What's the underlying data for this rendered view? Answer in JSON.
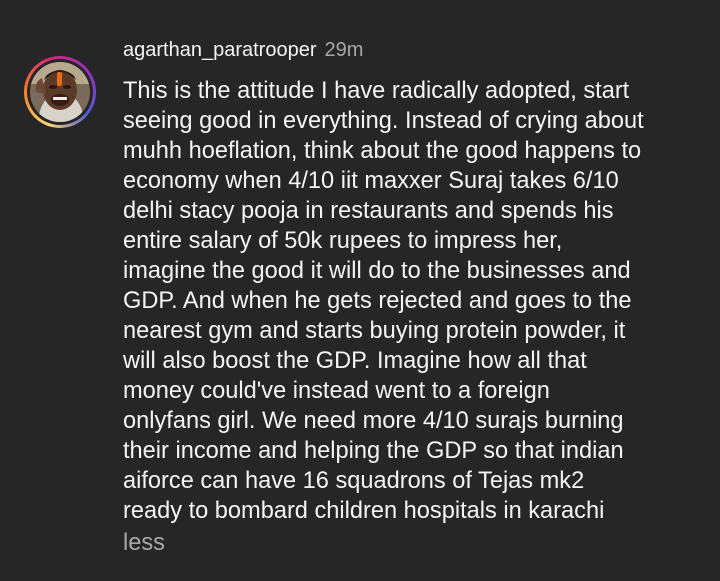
{
  "comment": {
    "username": "agarthan_paratrooper",
    "timestamp": "29m",
    "avatar": "profile-photo",
    "body_lines": [
      "This is the attitude I have radically adopted, start",
      "seeing good in everything. Instead of crying about",
      "muhh hoeflation, think about the good happens to",
      "economy when 4/10 iit maxxer Suraj takes 6/10",
      "delhi stacy pooja in restaurants and spends his",
      "entire salary of 50k rupees to impress her,",
      "imagine the good it will do to the businesses and",
      "GDP. And when he gets rejected and goes to the",
      "nearest gym and starts buying protein powder, it",
      "will also boost the GDP. Imagine how all that",
      "money could've instead went to a foreign",
      "onlyfans girl. We need more 4/10 surajs burning",
      "their income and helping the GDP so that indian",
      "aiforce can have 16 squadrons of Tejas mk2",
      "ready to bombard children hospitals in karachi"
    ],
    "less_label": "less"
  },
  "colors": {
    "background": "#262626",
    "text_primary": "#f5f5f5",
    "text_secondary": "#a8a8a8",
    "story_ring": [
      "#feda75",
      "#fa7e1e",
      "#d62976",
      "#962fbf",
      "#4f5bd5"
    ]
  }
}
